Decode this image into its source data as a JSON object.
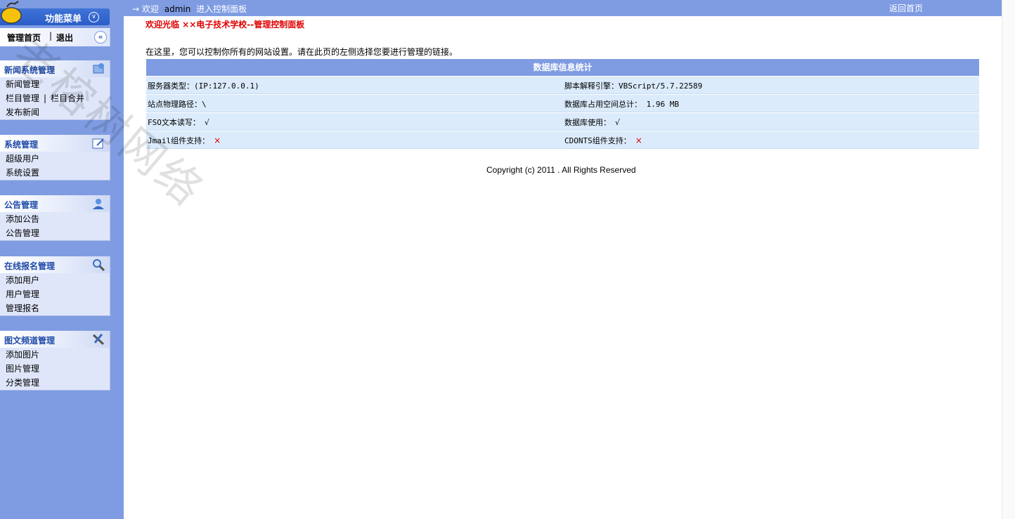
{
  "sidebar": {
    "menu_title": "功能菜单",
    "home_link": "管理首页",
    "separator": "|",
    "logout_link": "退出",
    "groups": [
      {
        "title": "新闻系统管理",
        "icon": "news-icon",
        "items": [
          "新闻管理",
          "栏目管理",
          "栏目合并",
          "发布新闻"
        ]
      },
      {
        "title": "系统管理",
        "icon": "edit-icon",
        "items": [
          "超级用户",
          "系统设置"
        ]
      },
      {
        "title": "公告管理",
        "icon": "user-icon",
        "items": [
          "添加公告",
          "公告管理"
        ]
      },
      {
        "title": "在线报名管理",
        "icon": "search-icon",
        "items": [
          "添加用户",
          "用户管理",
          "管理报名"
        ]
      },
      {
        "title": "图文频道管理",
        "icon": "tools-icon",
        "items": [
          "添加图片",
          "图片管理",
          "分类管理"
        ]
      }
    ]
  },
  "topbar": {
    "arrow": "→",
    "welcome": "欢迎",
    "user": "admin",
    "enter": "进入控制面板",
    "back_home": "返回首页"
  },
  "main": {
    "title": "欢迎光临 ××电子技术学校--管理控制面板",
    "intro": "在这里，您可以控制你所有的网站设置。请在此页的左侧选择您要进行管理的链接。",
    "table_title": "数据库信息统计",
    "rows": [
      {
        "left": "服务器类型：(IP:127.0.0.1)",
        "right": "脚本解释引擎：VBScript/5.7.22589"
      },
      {
        "left": "站点物理路径：\\",
        "right": "数据库占用空间总计： 1.96 MB"
      },
      {
        "left": "FSO文本读写：",
        "left_mark": "√",
        "right": "数据库使用：",
        "right_mark": "√"
      },
      {
        "left": "Jmail组件支持：",
        "left_mark": "×",
        "right": "CDONTS组件支持：",
        "right_mark": "×"
      }
    ],
    "copyright": "Copyright (c) 2011 . All Rights Reserved"
  },
  "watermark": "老榕树网络"
}
